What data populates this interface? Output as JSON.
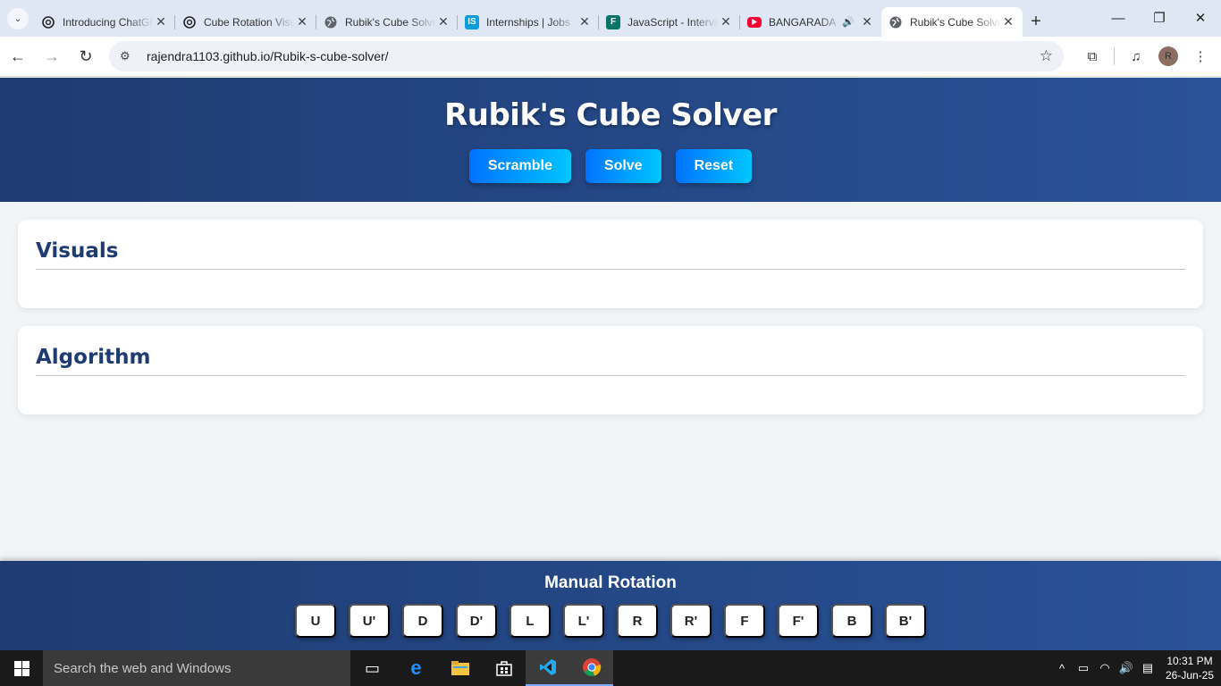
{
  "browser": {
    "tabs": [
      {
        "title": "Introducing ChatGPT",
        "icon": "openai-icon"
      },
      {
        "title": "Cube Rotation Visualizer",
        "icon": "openai-icon"
      },
      {
        "title": "Rubik's Cube Solver",
        "icon": "globe-icon"
      },
      {
        "title": "Internships | Jobs",
        "icon": "internshala-icon"
      },
      {
        "title": "JavaScript - Interview",
        "icon": "forms-icon"
      },
      {
        "title": "BANGARADA",
        "icon": "youtube-icon"
      },
      {
        "title": "Rubik's Cube Solver",
        "icon": "globe-icon"
      }
    ],
    "active_tab": 6,
    "url": "rajendra1103.github.io/Rubik-s-cube-solver/",
    "profile_initial": "R"
  },
  "app": {
    "title": "Rubik's Cube Solver",
    "buttons": {
      "scramble": "Scramble",
      "solve": "Solve",
      "reset": "Reset"
    },
    "sections": {
      "visuals": "Visuals",
      "algorithm": "Algorithm"
    },
    "footer": {
      "title": "Manual Rotation",
      "moves": [
        "U",
        "U'",
        "D",
        "D'",
        "L",
        "L'",
        "R",
        "R'",
        "F",
        "F'",
        "B",
        "B'"
      ]
    }
  },
  "taskbar": {
    "search_placeholder": "Search the web and Windows",
    "time": "10:31 PM",
    "date": "26-Jun-25"
  },
  "colors": {
    "header_gradient": [
      "#1e3c72",
      "#2a5298"
    ],
    "button_gradient": [
      "#0072ff",
      "#00c6ff"
    ],
    "heading": "#1e3c72"
  }
}
